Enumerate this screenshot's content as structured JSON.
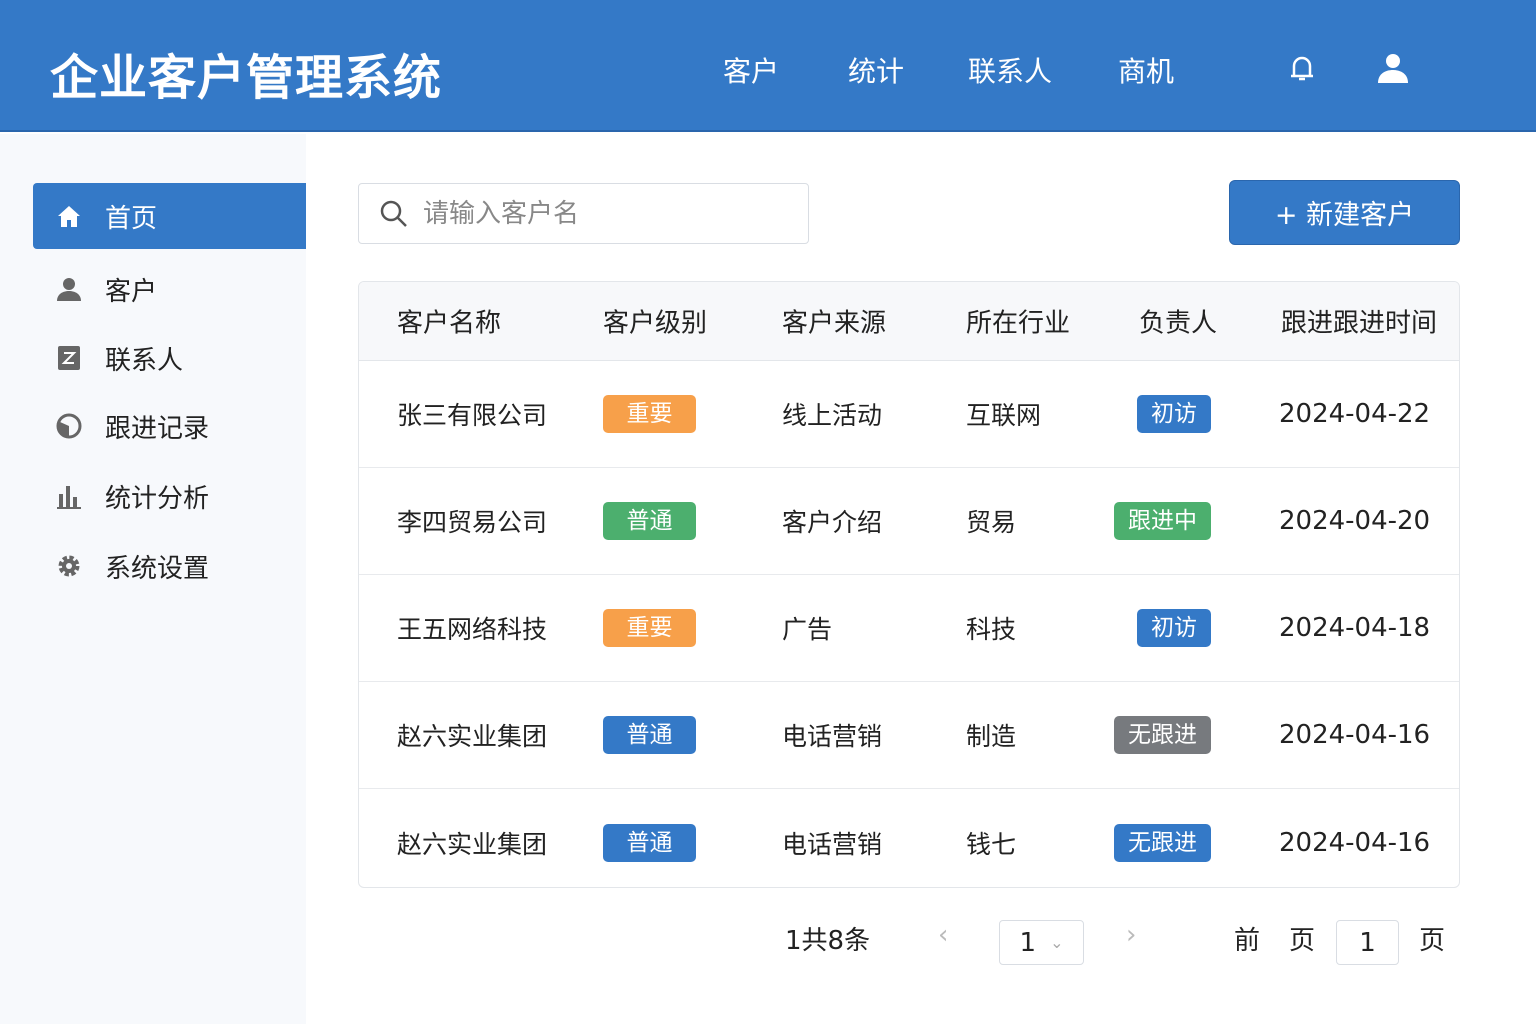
{
  "header": {
    "title": "企业客户管理系统",
    "nav": [
      "客户",
      "统计",
      "联系人",
      "商机"
    ]
  },
  "sidebar": {
    "items": [
      {
        "label": "首页",
        "icon": "home-icon"
      },
      {
        "label": "客户",
        "icon": "user-icon"
      },
      {
        "label": "联系人",
        "icon": "contact-icon"
      },
      {
        "label": "跟进记录",
        "icon": "record-icon"
      },
      {
        "label": "统计分析",
        "icon": "chart-icon"
      },
      {
        "label": "系统设置",
        "icon": "gear-icon"
      }
    ]
  },
  "search": {
    "placeholder": "请输入客户名"
  },
  "toolbar": {
    "add_label": "+ 新建客户"
  },
  "table": {
    "headers": [
      "客户名称",
      "客户级别",
      "客户来源",
      "所在行业",
      "负责人",
      "跟进跟进时间"
    ],
    "rows": [
      {
        "name": "张三有限公司",
        "level": "重要",
        "level_color": "#f7a04a",
        "source": "线上活动",
        "industry": "互联网",
        "status": "初访",
        "status_color": "#3479c7",
        "date": "2024-04-22"
      },
      {
        "name": "李四贸易公司",
        "level": "普通",
        "level_color": "#4caf6e",
        "source": "客户介绍",
        "industry": "贸易",
        "status": "跟进中",
        "status_color": "#4caf6e",
        "date": "2024-04-20"
      },
      {
        "name": "王五网络科技",
        "level": "重要",
        "level_color": "#f7a04a",
        "source": "广告",
        "industry": "科技",
        "status": "初访",
        "status_color": "#3479c7",
        "date": "2024-04-18"
      },
      {
        "name": "赵六实业集团",
        "level": "普通",
        "level_color": "#3479c7",
        "source": "电话营销",
        "industry": "制造",
        "status": "无跟进",
        "status_color": "#777a7e",
        "date": "2024-04-16"
      },
      {
        "name": "赵六实业集团",
        "level": "普通",
        "level_color": "#3479c7",
        "source": "电话营销",
        "industry": "钱七",
        "status": "无跟进",
        "status_color": "#3479c7",
        "date": "2024-04-16"
      }
    ]
  },
  "pagination": {
    "total": "1共8条",
    "page_select": "1",
    "goto_prefix": "前",
    "goto_page_label": "页",
    "goto_value": "1",
    "goto_suffix": "页"
  }
}
